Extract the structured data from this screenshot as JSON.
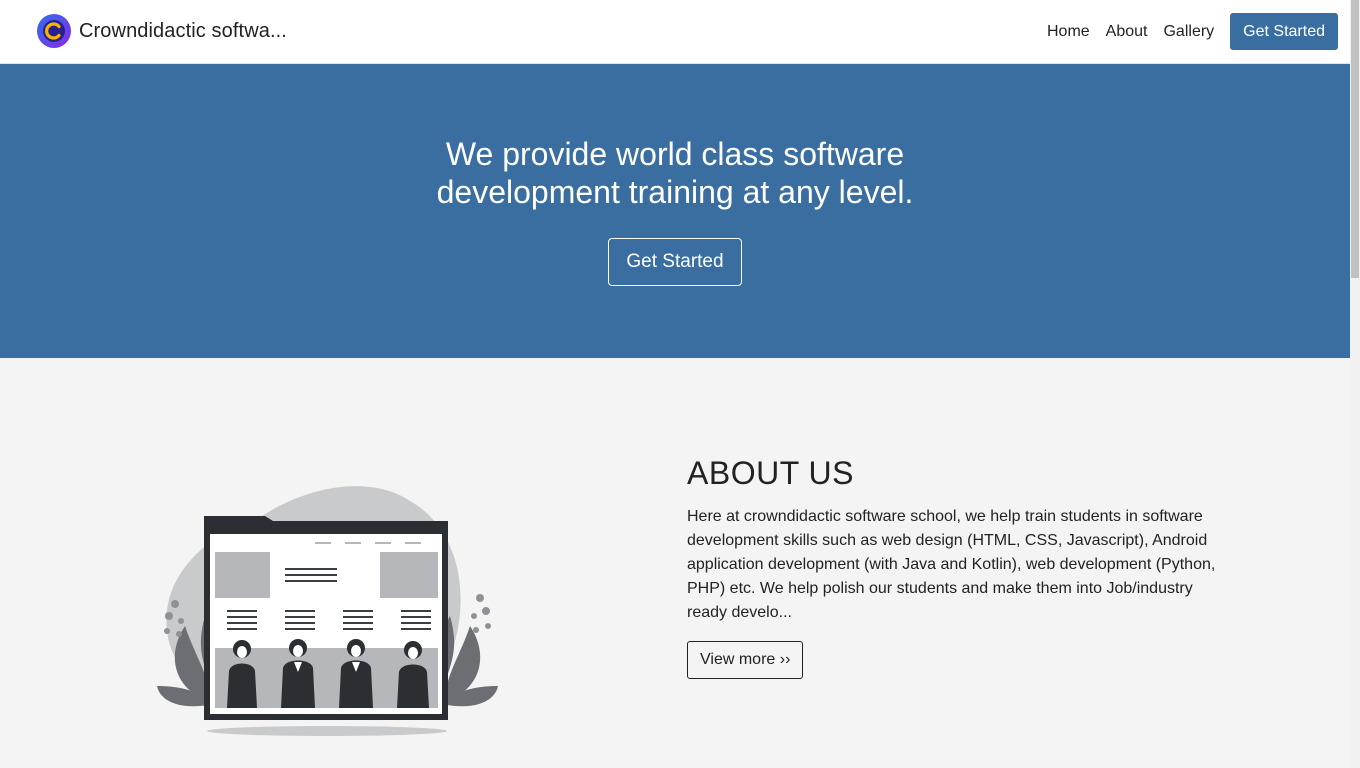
{
  "navbar": {
    "brand_name": "Crowndidactic softwa...",
    "brand_logo_icon": "crowndidactic-c-logo-icon",
    "links": [
      "Home",
      "About",
      "Gallery"
    ],
    "cta_label": "Get Started"
  },
  "hero": {
    "title_line1": "We provide world class software",
    "title_line2": "development training at any level.",
    "button_label": "Get Started"
  },
  "about": {
    "heading": "ABOUT US",
    "body": "Here at crowndidactic software school, we help train students in software development skills such as web design (HTML, CSS, Javascript), Android application development (with Java and Kotlin), web development (Python, PHP) etc. We help polish our students and make them into Job/industry ready develo...",
    "button_label": "View more ››",
    "illustration": "team-in-front-of-website-illustration"
  },
  "colors": {
    "primary": "#3a6ea1",
    "background": "#f4f4f4",
    "navbar_bg": "#ffffff",
    "text": "#222222"
  }
}
